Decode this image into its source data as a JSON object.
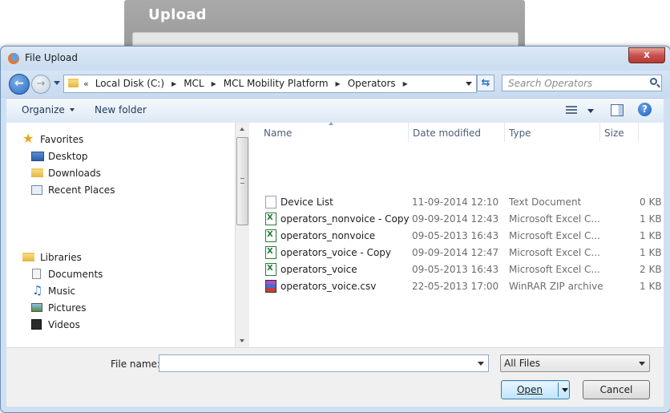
{
  "background": {
    "title": "Upload"
  },
  "dialog": {
    "title": "File Upload",
    "close_label": "x"
  },
  "nav": {
    "back_icon": "back-arrow-icon",
    "forward_icon": "forward-arrow-icon",
    "breadcrumb_prefix": "«",
    "breadcrumbs": [
      "Local Disk (C:)",
      "MCL",
      "MCL Mobility Platform",
      "Operators"
    ],
    "search_placeholder": "Search Operators"
  },
  "toolbar": {
    "organize": "Organize",
    "new_folder": "New folder"
  },
  "sidebar": {
    "favorites_label": "Favorites",
    "favorites": [
      "Desktop",
      "Downloads",
      "Recent Places"
    ],
    "libraries_label": "Libraries",
    "libraries": [
      "Documents",
      "Music",
      "Pictures",
      "Videos"
    ]
  },
  "files": {
    "columns": [
      "Name",
      "Date modified",
      "Type",
      "Size"
    ],
    "rows": [
      {
        "name": "Device List",
        "date": "11-09-2014 12:10",
        "type": "Text Document",
        "size": "0 KB",
        "icon": "text-document-icon"
      },
      {
        "name": "operators_nonvoice - Copy",
        "date": "09-09-2014 12:43",
        "type": "Microsoft Excel C...",
        "size": "1 KB",
        "icon": "excel-icon"
      },
      {
        "name": "operators_nonvoice",
        "date": "09-05-2013 16:43",
        "type": "Microsoft Excel C...",
        "size": "1 KB",
        "icon": "excel-icon"
      },
      {
        "name": "operators_voice - Copy",
        "date": "09-09-2014 12:47",
        "type": "Microsoft Excel C...",
        "size": "1 KB",
        "icon": "excel-icon"
      },
      {
        "name": "operators_voice",
        "date": "09-05-2013 16:43",
        "type": "Microsoft Excel C...",
        "size": "2 KB",
        "icon": "excel-icon"
      },
      {
        "name": "operators_voice.csv",
        "date": "22-05-2013 17:00",
        "type": "WinRAR ZIP archive",
        "size": "1 KB",
        "icon": "winrar-icon"
      }
    ]
  },
  "bottom": {
    "file_name_label": "File name:",
    "file_name_value": "",
    "file_type": "All Files",
    "open_label": "Open",
    "cancel_label": "Cancel"
  }
}
